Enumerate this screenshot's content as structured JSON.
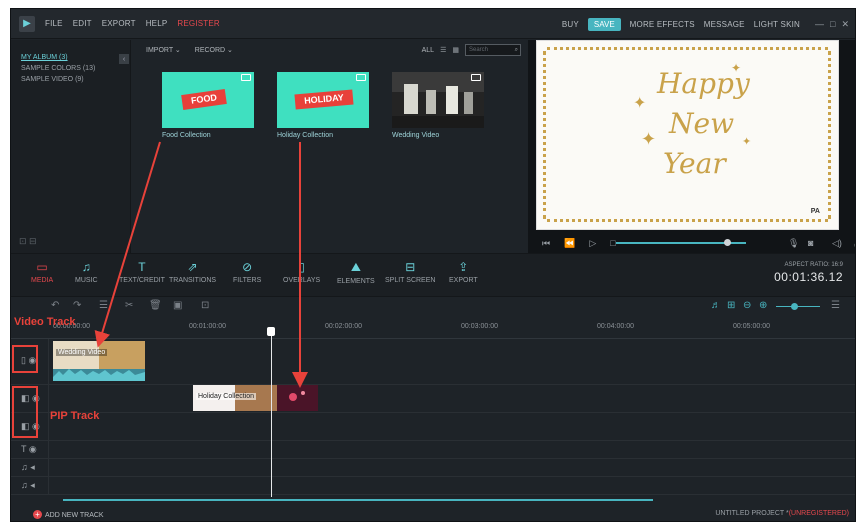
{
  "menubar": {
    "items": [
      "FILE",
      "EDIT",
      "EXPORT",
      "HELP",
      "REGISTER"
    ],
    "right": [
      "BUY",
      "SAVE",
      "MORE EFFECTS",
      "MESSAGE",
      "LIGHT SKIN"
    ],
    "window": [
      "—",
      "□",
      "✕"
    ]
  },
  "sidebar": {
    "items": [
      "MY ALBUM (3)",
      "SAMPLE COLORS (13)",
      "SAMPLE VIDEO (9)"
    ]
  },
  "library": {
    "import_label": "IMPORT ⌄",
    "record_label": "RECORD ⌄",
    "filter_label": "ALL",
    "search_placeholder": "Search",
    "items": [
      {
        "label": "Food Collection",
        "tag": "FOOD"
      },
      {
        "label": "Holiday Collection",
        "tag": "HOLIDAY"
      },
      {
        "label": "Wedding Video",
        "tag": ""
      }
    ]
  },
  "preview": {
    "line1": "Happy",
    "line2": "New",
    "line3": "Year",
    "watermark": "PA"
  },
  "toolbar": {
    "tools": [
      "MEDIA",
      "MUSIC",
      "TEXT/CREDIT",
      "TRANSITIONS",
      "FILTERS",
      "OVERLAYS",
      "ELEMENTS",
      "SPLIT SCREEN",
      "EXPORT"
    ],
    "aspect_ratio": "ASPECT RATIO: 16:9",
    "timecode": "00:01:36.12"
  },
  "timeline": {
    "ticks": [
      "00:00:00:00",
      "00:01:00:00",
      "00:02:00:00",
      "00:03:00:00",
      "00:04:00:00",
      "00:05:00:00"
    ],
    "video_clip": "Wedding Video",
    "pip_clip": "Holiday Collection",
    "add_track": "ADD NEW TRACK",
    "project": "UNTITLED PROJECT *",
    "unregistered": "(UNREGISTERED)"
  },
  "annotations": {
    "video_track": "Video Track",
    "pip_track": "PIP Track"
  },
  "colors": {
    "accent": "#48b5c0",
    "annotation": "#e8423a",
    "brand_red": "#e5484d"
  }
}
